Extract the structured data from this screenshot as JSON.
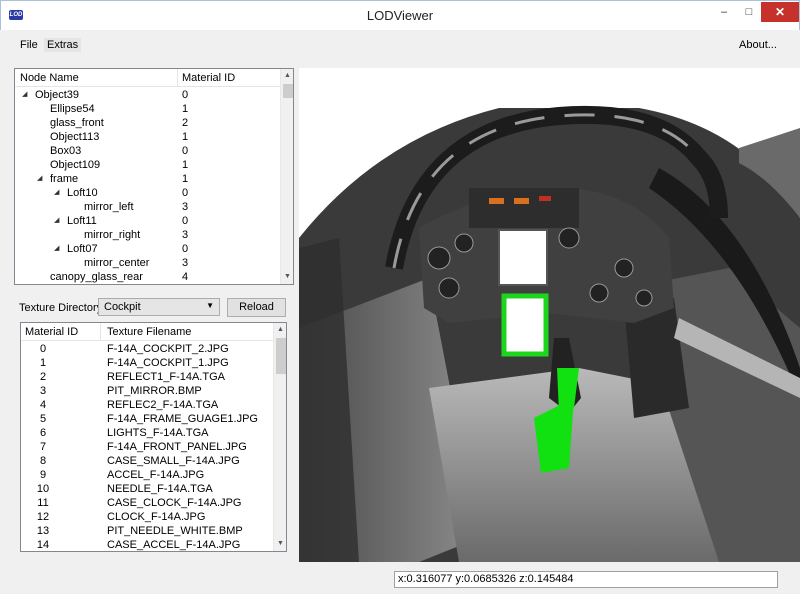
{
  "window": {
    "title": "LODViewer",
    "icon_text": "LOD"
  },
  "menu": {
    "file": "File",
    "extras": "Extras",
    "about": "About..."
  },
  "tree": {
    "columns": [
      "Node Name",
      "Material ID"
    ],
    "rows": [
      {
        "name": "Object39",
        "mat": "0",
        "depth": 0,
        "expanded": true
      },
      {
        "name": "Ellipse54",
        "mat": "1",
        "depth": 1
      },
      {
        "name": "glass_front",
        "mat": "2",
        "depth": 1
      },
      {
        "name": "Object113",
        "mat": "1",
        "depth": 1
      },
      {
        "name": "Box03",
        "mat": "0",
        "depth": 1
      },
      {
        "name": "Object109",
        "mat": "1",
        "depth": 1
      },
      {
        "name": "frame",
        "mat": "1",
        "depth": 1,
        "expanded": true
      },
      {
        "name": "Loft10",
        "mat": "0",
        "depth": 2,
        "expanded": true
      },
      {
        "name": "mirror_left",
        "mat": "3",
        "depth": 3
      },
      {
        "name": "Loft11",
        "mat": "0",
        "depth": 2,
        "expanded": true
      },
      {
        "name": "mirror_right",
        "mat": "3",
        "depth": 3
      },
      {
        "name": "Loft07",
        "mat": "0",
        "depth": 2,
        "expanded": true
      },
      {
        "name": "mirror_center",
        "mat": "3",
        "depth": 3
      },
      {
        "name": "canopy_glass_rear",
        "mat": "4",
        "depth": 1
      }
    ]
  },
  "texture_dir": {
    "label": "Texture Directory:",
    "value": "Cockpit",
    "reload": "Reload"
  },
  "textures": {
    "columns": [
      "Material ID",
      "Texture Filename"
    ],
    "rows": [
      {
        "id": "0",
        "file": "F-14A_COCKPIT_2.JPG"
      },
      {
        "id": "1",
        "file": "F-14A_COCKPIT_1.JPG"
      },
      {
        "id": "2",
        "file": "REFLECT1_F-14A.TGA"
      },
      {
        "id": "3",
        "file": "PIT_MIRROR.BMP"
      },
      {
        "id": "4",
        "file": "REFLEC2_F-14A.TGA"
      },
      {
        "id": "5",
        "file": "F-14A_FRAME_GUAGE1.JPG"
      },
      {
        "id": "6",
        "file": "LIGHTS_F-14A.TGA"
      },
      {
        "id": "7",
        "file": "F-14A_FRONT_PANEL.JPG"
      },
      {
        "id": "8",
        "file": "CASE_SMALL_F-14A.JPG"
      },
      {
        "id": "9",
        "file": "ACCEL_F-14A.JPG"
      },
      {
        "id": "10",
        "file": "NEEDLE_F-14A.TGA"
      },
      {
        "id": "11",
        "file": "CASE_CLOCK_F-14A.JPG"
      },
      {
        "id": "12",
        "file": "CLOCK_F-14A.JPG"
      },
      {
        "id": "13",
        "file": "PIT_NEEDLE_WHITE.BMP"
      },
      {
        "id": "14",
        "file": "CASE_ACCEL_F-14A.JPG"
      }
    ]
  },
  "status": {
    "coords": "x:0.316077 y:0.0685326 z:0.145484"
  }
}
